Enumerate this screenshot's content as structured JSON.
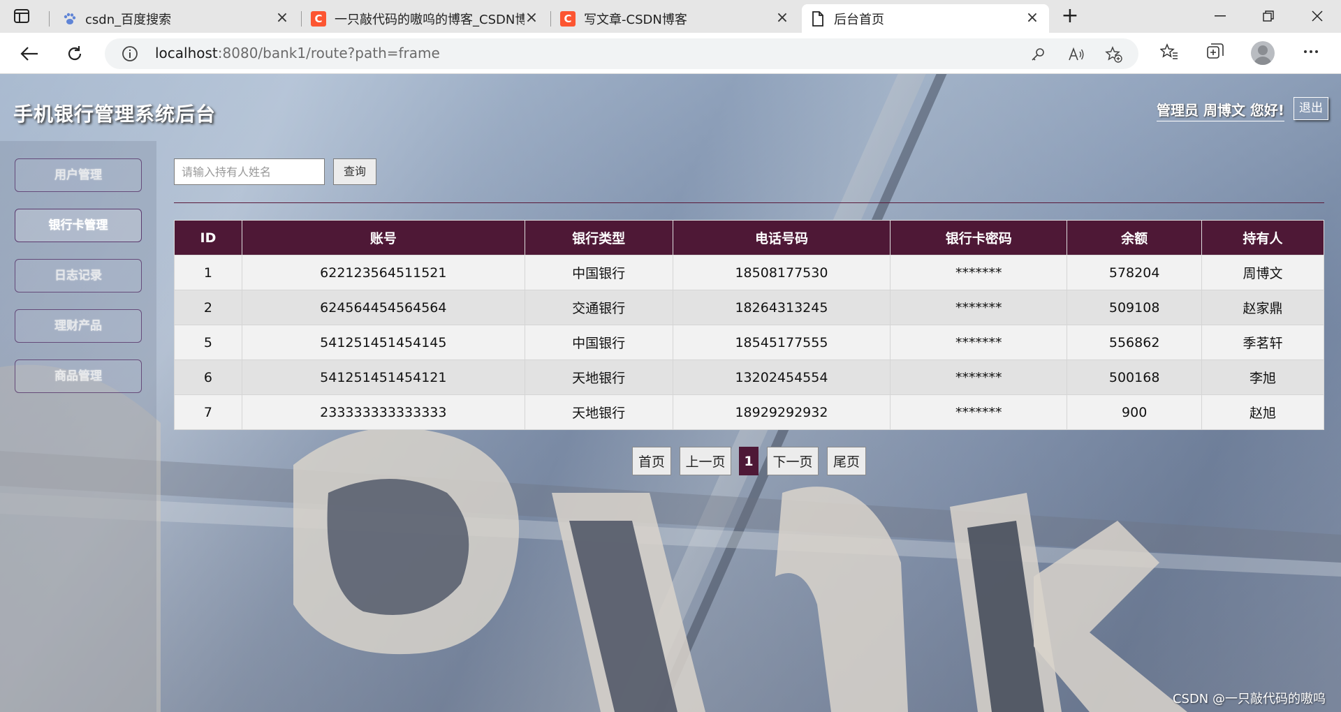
{
  "browser": {
    "tabs": [
      {
        "title": "csdn_百度搜索",
        "favicon": "paw-icon",
        "active": false
      },
      {
        "title": "一只敲代码的嗷呜的博客_CSDN博",
        "favicon": "csdn-icon",
        "active": false
      },
      {
        "title": "写文章-CSDN博客",
        "favicon": "csdn-icon",
        "active": false
      },
      {
        "title": "后台首页",
        "favicon": "page-icon",
        "active": true
      }
    ],
    "url_host": "localhost",
    "url_rest": ":8080/bank1/route?path=frame",
    "colors": {
      "csdn_favicon": "#fc5531",
      "baidu_favicon": "#5f84d6"
    }
  },
  "header": {
    "system_title": "手机银行管理系统后台",
    "greeting": "管理员 周博文 您好!",
    "logout_label": "退出"
  },
  "sidebar": {
    "items": [
      {
        "label": "用户管理",
        "active": false
      },
      {
        "label": "银行卡管理",
        "active": true
      },
      {
        "label": "日志记录",
        "active": false
      },
      {
        "label": "理财产品",
        "active": false
      },
      {
        "label": "商品管理",
        "active": false
      }
    ]
  },
  "search": {
    "placeholder": "请输入持有人姓名",
    "value": "",
    "button_label": "查询"
  },
  "table": {
    "headers": [
      "ID",
      "账号",
      "银行类型",
      "电话号码",
      "银行卡密码",
      "余额",
      "持有人"
    ],
    "rows": [
      [
        "1",
        "622123564511521",
        "中国银行",
        "18508177530",
        "*******",
        "578204",
        "周博文"
      ],
      [
        "2",
        "624564454564564",
        "交通银行",
        "18264313245",
        "*******",
        "509108",
        "赵家鼎"
      ],
      [
        "5",
        "541251451454145",
        "中国银行",
        "18545177555",
        "*******",
        "556862",
        "季茗轩"
      ],
      [
        "6",
        "541251451454121",
        "天地银行",
        "13202454554",
        "*******",
        "500168",
        "李旭"
      ],
      [
        "7",
        "233333333333333",
        "天地银行",
        "18929292932",
        "*******",
        "900",
        "赵旭"
      ]
    ],
    "colors": {
      "header_bg": "#4e1836",
      "row_odd": "#f2f2f2",
      "row_even": "#e2e2e2"
    }
  },
  "pagination": {
    "first": "首页",
    "prev": "上一页",
    "current": "1",
    "next": "下一页",
    "last": "尾页"
  },
  "watermark": "CSDN @一只敲代码的嗷呜"
}
